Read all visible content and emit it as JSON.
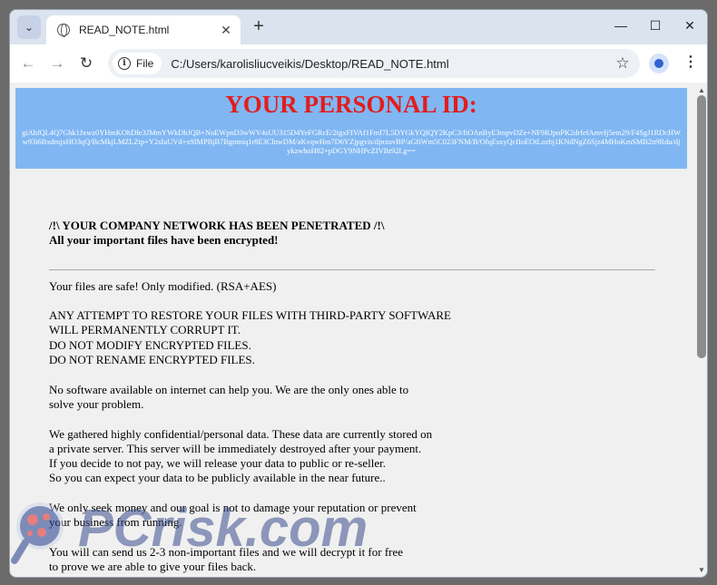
{
  "browser": {
    "tab_title": "READ_NOTE.html",
    "new_tab_label": "+",
    "site_info_label": "File",
    "url": "C:/Users/karolisliucveikis/Desktop/READ_NOTE.html"
  },
  "note": {
    "id_title": "YOUR PERSONAL ID:",
    "id_code": "giAhfQL4Q7Ghk1Jxwz0YHmKOhDfe3JMmYWkDhJQB+NoEWpnD3wWV4sUU315D4YeFGRcE/2tgxFIVAf1FmI7L5DYGkYQIQY2KpC3/fiOAnByE3mpvDZe+NF9RJpoPK2drfefAmvIj5em29/F4SgJ1RDcHWw93i6BxdmjxHO3qQ/BcMkjLMZLZtp+Y2sIuUVd+x9IMPBjB7Bgnmiq1r8E3ClnwDM/aKvqwHm7D6YZjpgvis/djnxuvBP/aGfiWm5C023FNM/B/OfqEsxyQcIIoEOtLozbj1KNdNgZ6Sjz4MHoKmSMB2n9Rdu/djykzwhoH82+pDGY9NHPcZIVBr92I.g=="
  },
  "content": {
    "headline1": "/!\\ YOUR COMPANY NETWORK HAS BEEN PENETRATED /!\\",
    "headline2": "All your important files have been encrypted!",
    "p1": "Your files are safe! Only modified. (RSA+AES)",
    "p2_l1": "ANY ATTEMPT TO RESTORE YOUR FILES WITH THIRD-PARTY SOFTWARE",
    "p2_l2": "WILL PERMANENTLY CORRUPT IT.",
    "p2_l3": "DO NOT MODIFY ENCRYPTED FILES.",
    "p2_l4": "DO NOT RENAME ENCRYPTED FILES.",
    "p3_l1": "No software available on internet can help you. We are the only ones able to",
    "p3_l2": "solve your problem.",
    "p4_l1": "We gathered highly confidential/personal data. These data are currently stored on",
    "p4_l2": "a private server. This server will be immediately destroyed after your payment.",
    "p4_l3": "If you decide to not pay, we will release your data to public or re-seller.",
    "p4_l4": "So you can expect your data to be publicly available in the near future..",
    "p5_l1": "We only seek money and our goal is not to damage your reputation or prevent",
    "p5_l2": "your business from running.",
    "p6_l1": "You will can send us 2-3 non-important files and we will decrypt it for free",
    "p6_l2": "to prove we are able to give your files back."
  },
  "watermark": {
    "text": "PCrisk.com"
  },
  "colors": {
    "id_box": "#80b7f2",
    "id_title": "#e31d1d"
  }
}
